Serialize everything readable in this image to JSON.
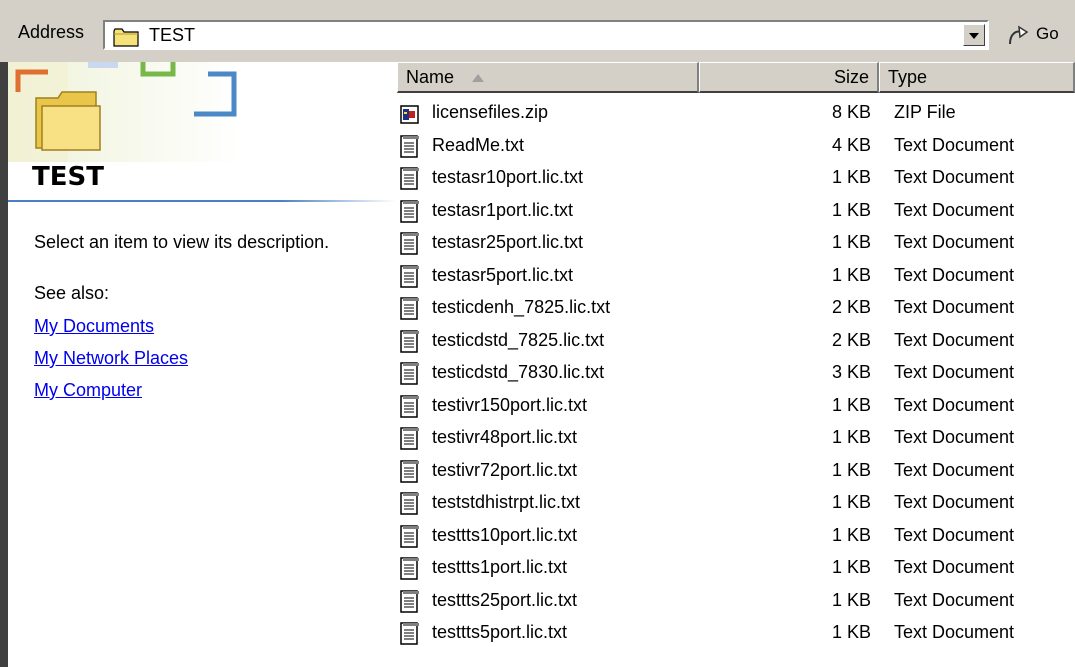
{
  "address": {
    "label": "Address",
    "path": "TEST",
    "go_label": "Go"
  },
  "left_panel": {
    "title": "TEST",
    "description": "Select an item to view its description.",
    "see_also_label": "See also:",
    "links": [
      "My Documents",
      "My Network Places",
      "My Computer"
    ],
    "link_color": "#0000ee"
  },
  "file_list": {
    "columns": [
      "Name",
      "Size",
      "Type"
    ],
    "sort_column": "Name",
    "rows": [
      {
        "name": "licensefiles.zip",
        "size": "8 KB",
        "type": "ZIP File",
        "icon": "zip-file-icon"
      },
      {
        "name": "ReadMe.txt",
        "size": "4 KB",
        "type": "Text Document",
        "icon": "text-document-icon"
      },
      {
        "name": "testasr10port.lic.txt",
        "size": "1 KB",
        "type": "Text Document",
        "icon": "text-document-icon"
      },
      {
        "name": "testasr1port.lic.txt",
        "size": "1 KB",
        "type": "Text Document",
        "icon": "text-document-icon"
      },
      {
        "name": "testasr25port.lic.txt",
        "size": "1 KB",
        "type": "Text Document",
        "icon": "text-document-icon"
      },
      {
        "name": "testasr5port.lic.txt",
        "size": "1 KB",
        "type": "Text Document",
        "icon": "text-document-icon"
      },
      {
        "name": "testicdenh_7825.lic.txt",
        "size": "2 KB",
        "type": "Text Document",
        "icon": "text-document-icon"
      },
      {
        "name": "testicdstd_7825.lic.txt",
        "size": "2 KB",
        "type": "Text Document",
        "icon": "text-document-icon"
      },
      {
        "name": "testicdstd_7830.lic.txt",
        "size": "3 KB",
        "type": "Text Document",
        "icon": "text-document-icon"
      },
      {
        "name": "testivr150port.lic.txt",
        "size": "1 KB",
        "type": "Text Document",
        "icon": "text-document-icon"
      },
      {
        "name": "testivr48port.lic.txt",
        "size": "1 KB",
        "type": "Text Document",
        "icon": "text-document-icon"
      },
      {
        "name": "testivr72port.lic.txt",
        "size": "1 KB",
        "type": "Text Document",
        "icon": "text-document-icon"
      },
      {
        "name": "teststdhistrpt.lic.txt",
        "size": "1 KB",
        "type": "Text Document",
        "icon": "text-document-icon"
      },
      {
        "name": "testtts10port.lic.txt",
        "size": "1 KB",
        "type": "Text Document",
        "icon": "text-document-icon"
      },
      {
        "name": "testtts1port.lic.txt",
        "size": "1 KB",
        "type": "Text Document",
        "icon": "text-document-icon"
      },
      {
        "name": "testtts25port.lic.txt",
        "size": "1 KB",
        "type": "Text Document",
        "icon": "text-document-icon"
      },
      {
        "name": "testtts5port.lic.txt",
        "size": "1 KB",
        "type": "Text Document",
        "icon": "text-document-icon"
      }
    ]
  }
}
